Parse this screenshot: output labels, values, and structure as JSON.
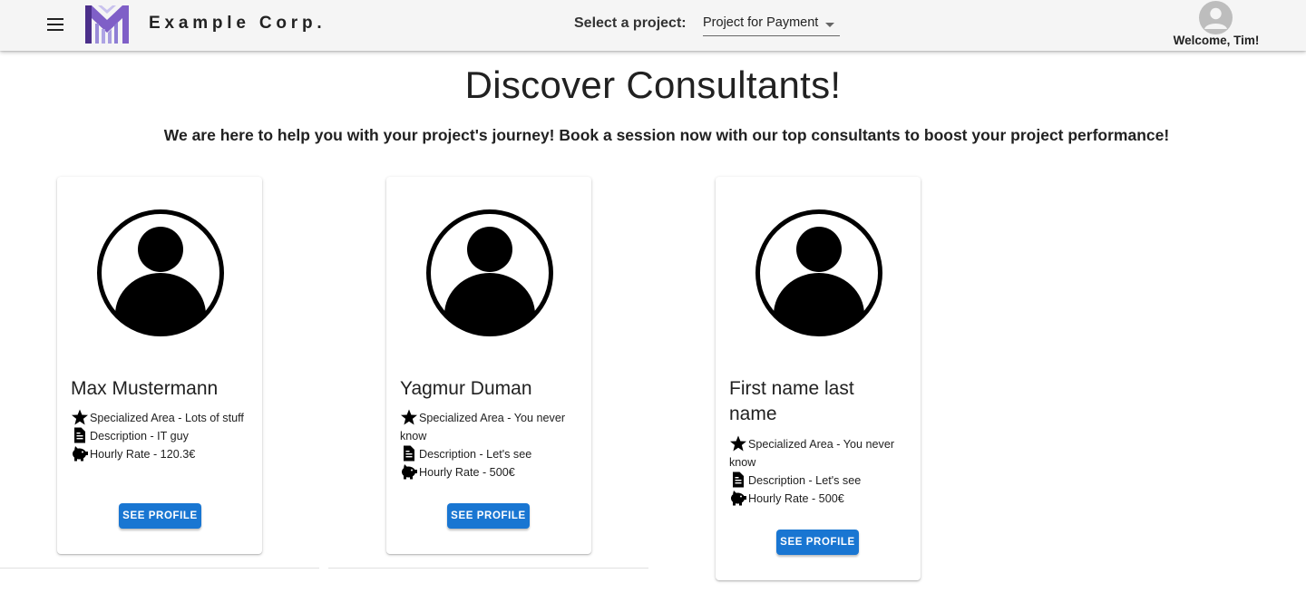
{
  "header": {
    "brand": "Example Corp.",
    "project_label": "Select a project:",
    "project_value": "Project for Payment",
    "welcome": "Welcome, Tim!"
  },
  "main": {
    "title": "Discover Consultants!",
    "subtitle": "We are here to help you with your project's journey! Book a session now with our top consultants to boost your project performance!"
  },
  "consultants": [
    {
      "name": "Max Mustermann",
      "specialized": "Specialized Area - Lots of stuff",
      "description": "Description - IT guy",
      "rate": "Hourly Rate - 120.3€",
      "button": "See Profile"
    },
    {
      "name": "Yagmur Duman",
      "specialized": "Specialized Area - You never know",
      "description": "Description - Let's see",
      "rate": "Hourly Rate - 500€",
      "button": "See Profile"
    },
    {
      "name": "First name last name",
      "specialized": "Specialized Area - You never know",
      "description": "Description - Let's see",
      "rate": "Hourly Rate - 500€",
      "button": "See Profile"
    }
  ],
  "icons": {
    "menu": "menu-icon",
    "avatar": "account-circle-icon",
    "specialized": "star-icon",
    "description": "document-icon",
    "rate": "piggy-bank-icon"
  },
  "colors": {
    "primary": "#1976d2",
    "appbar": "#f5f5f5",
    "logo_purple": "#5b3e9e"
  }
}
